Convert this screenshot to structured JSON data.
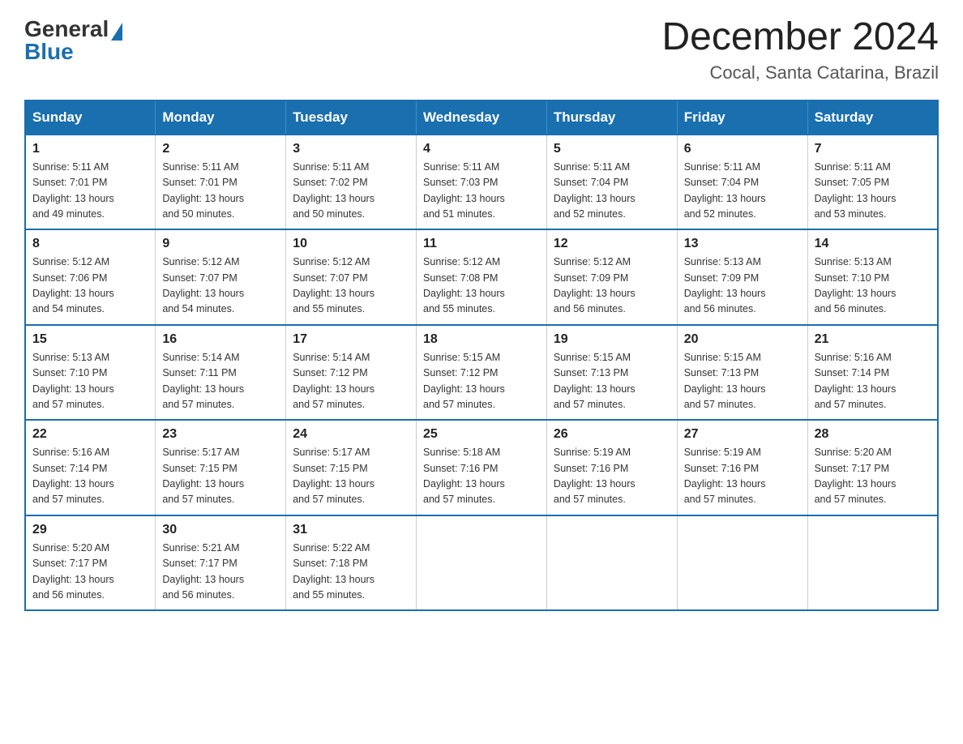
{
  "header": {
    "logo_general": "General",
    "logo_blue": "Blue",
    "month_title": "December 2024",
    "location": "Cocal, Santa Catarina, Brazil"
  },
  "days_of_week": [
    "Sunday",
    "Monday",
    "Tuesday",
    "Wednesday",
    "Thursday",
    "Friday",
    "Saturday"
  ],
  "weeks": [
    [
      {
        "day": "1",
        "sunrise": "5:11 AM",
        "sunset": "7:01 PM",
        "daylight": "13 hours and 49 minutes."
      },
      {
        "day": "2",
        "sunrise": "5:11 AM",
        "sunset": "7:01 PM",
        "daylight": "13 hours and 50 minutes."
      },
      {
        "day": "3",
        "sunrise": "5:11 AM",
        "sunset": "7:02 PM",
        "daylight": "13 hours and 50 minutes."
      },
      {
        "day": "4",
        "sunrise": "5:11 AM",
        "sunset": "7:03 PM",
        "daylight": "13 hours and 51 minutes."
      },
      {
        "day": "5",
        "sunrise": "5:11 AM",
        "sunset": "7:04 PM",
        "daylight": "13 hours and 52 minutes."
      },
      {
        "day": "6",
        "sunrise": "5:11 AM",
        "sunset": "7:04 PM",
        "daylight": "13 hours and 52 minutes."
      },
      {
        "day": "7",
        "sunrise": "5:11 AM",
        "sunset": "7:05 PM",
        "daylight": "13 hours and 53 minutes."
      }
    ],
    [
      {
        "day": "8",
        "sunrise": "5:12 AM",
        "sunset": "7:06 PM",
        "daylight": "13 hours and 54 minutes."
      },
      {
        "day": "9",
        "sunrise": "5:12 AM",
        "sunset": "7:07 PM",
        "daylight": "13 hours and 54 minutes."
      },
      {
        "day": "10",
        "sunrise": "5:12 AM",
        "sunset": "7:07 PM",
        "daylight": "13 hours and 55 minutes."
      },
      {
        "day": "11",
        "sunrise": "5:12 AM",
        "sunset": "7:08 PM",
        "daylight": "13 hours and 55 minutes."
      },
      {
        "day": "12",
        "sunrise": "5:12 AM",
        "sunset": "7:09 PM",
        "daylight": "13 hours and 56 minutes."
      },
      {
        "day": "13",
        "sunrise": "5:13 AM",
        "sunset": "7:09 PM",
        "daylight": "13 hours and 56 minutes."
      },
      {
        "day": "14",
        "sunrise": "5:13 AM",
        "sunset": "7:10 PM",
        "daylight": "13 hours and 56 minutes."
      }
    ],
    [
      {
        "day": "15",
        "sunrise": "5:13 AM",
        "sunset": "7:10 PM",
        "daylight": "13 hours and 57 minutes."
      },
      {
        "day": "16",
        "sunrise": "5:14 AM",
        "sunset": "7:11 PM",
        "daylight": "13 hours and 57 minutes."
      },
      {
        "day": "17",
        "sunrise": "5:14 AM",
        "sunset": "7:12 PM",
        "daylight": "13 hours and 57 minutes."
      },
      {
        "day": "18",
        "sunrise": "5:15 AM",
        "sunset": "7:12 PM",
        "daylight": "13 hours and 57 minutes."
      },
      {
        "day": "19",
        "sunrise": "5:15 AM",
        "sunset": "7:13 PM",
        "daylight": "13 hours and 57 minutes."
      },
      {
        "day": "20",
        "sunrise": "5:15 AM",
        "sunset": "7:13 PM",
        "daylight": "13 hours and 57 minutes."
      },
      {
        "day": "21",
        "sunrise": "5:16 AM",
        "sunset": "7:14 PM",
        "daylight": "13 hours and 57 minutes."
      }
    ],
    [
      {
        "day": "22",
        "sunrise": "5:16 AM",
        "sunset": "7:14 PM",
        "daylight": "13 hours and 57 minutes."
      },
      {
        "day": "23",
        "sunrise": "5:17 AM",
        "sunset": "7:15 PM",
        "daylight": "13 hours and 57 minutes."
      },
      {
        "day": "24",
        "sunrise": "5:17 AM",
        "sunset": "7:15 PM",
        "daylight": "13 hours and 57 minutes."
      },
      {
        "day": "25",
        "sunrise": "5:18 AM",
        "sunset": "7:16 PM",
        "daylight": "13 hours and 57 minutes."
      },
      {
        "day": "26",
        "sunrise": "5:19 AM",
        "sunset": "7:16 PM",
        "daylight": "13 hours and 57 minutes."
      },
      {
        "day": "27",
        "sunrise": "5:19 AM",
        "sunset": "7:16 PM",
        "daylight": "13 hours and 57 minutes."
      },
      {
        "day": "28",
        "sunrise": "5:20 AM",
        "sunset": "7:17 PM",
        "daylight": "13 hours and 57 minutes."
      }
    ],
    [
      {
        "day": "29",
        "sunrise": "5:20 AM",
        "sunset": "7:17 PM",
        "daylight": "13 hours and 56 minutes."
      },
      {
        "day": "30",
        "sunrise": "5:21 AM",
        "sunset": "7:17 PM",
        "daylight": "13 hours and 56 minutes."
      },
      {
        "day": "31",
        "sunrise": "5:22 AM",
        "sunset": "7:18 PM",
        "daylight": "13 hours and 55 minutes."
      },
      null,
      null,
      null,
      null
    ]
  ],
  "labels": {
    "sunrise": "Sunrise:",
    "sunset": "Sunset:",
    "daylight": "Daylight:"
  }
}
